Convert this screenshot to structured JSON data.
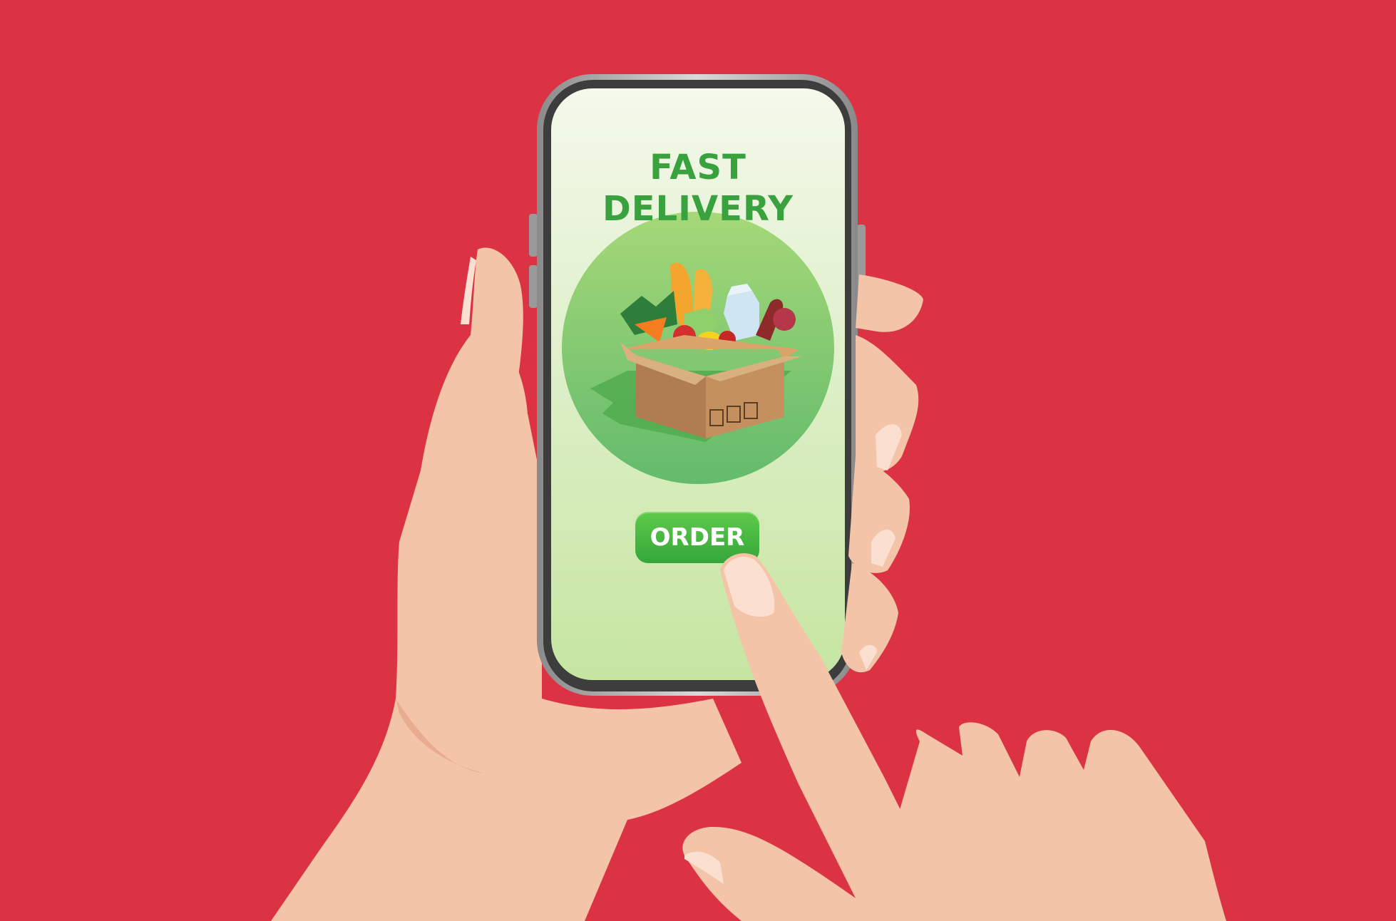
{
  "screen": {
    "title": "FAST DELIVERY",
    "order_button_label": "ORDER",
    "illustration_icon": "grocery-box-icon"
  },
  "colors": {
    "background": "#dc3344",
    "title_green": "#3aa13f",
    "button_green": "#45b33d",
    "skin": "#f3c4a8",
    "phone_frame": "#3d3d3d"
  }
}
